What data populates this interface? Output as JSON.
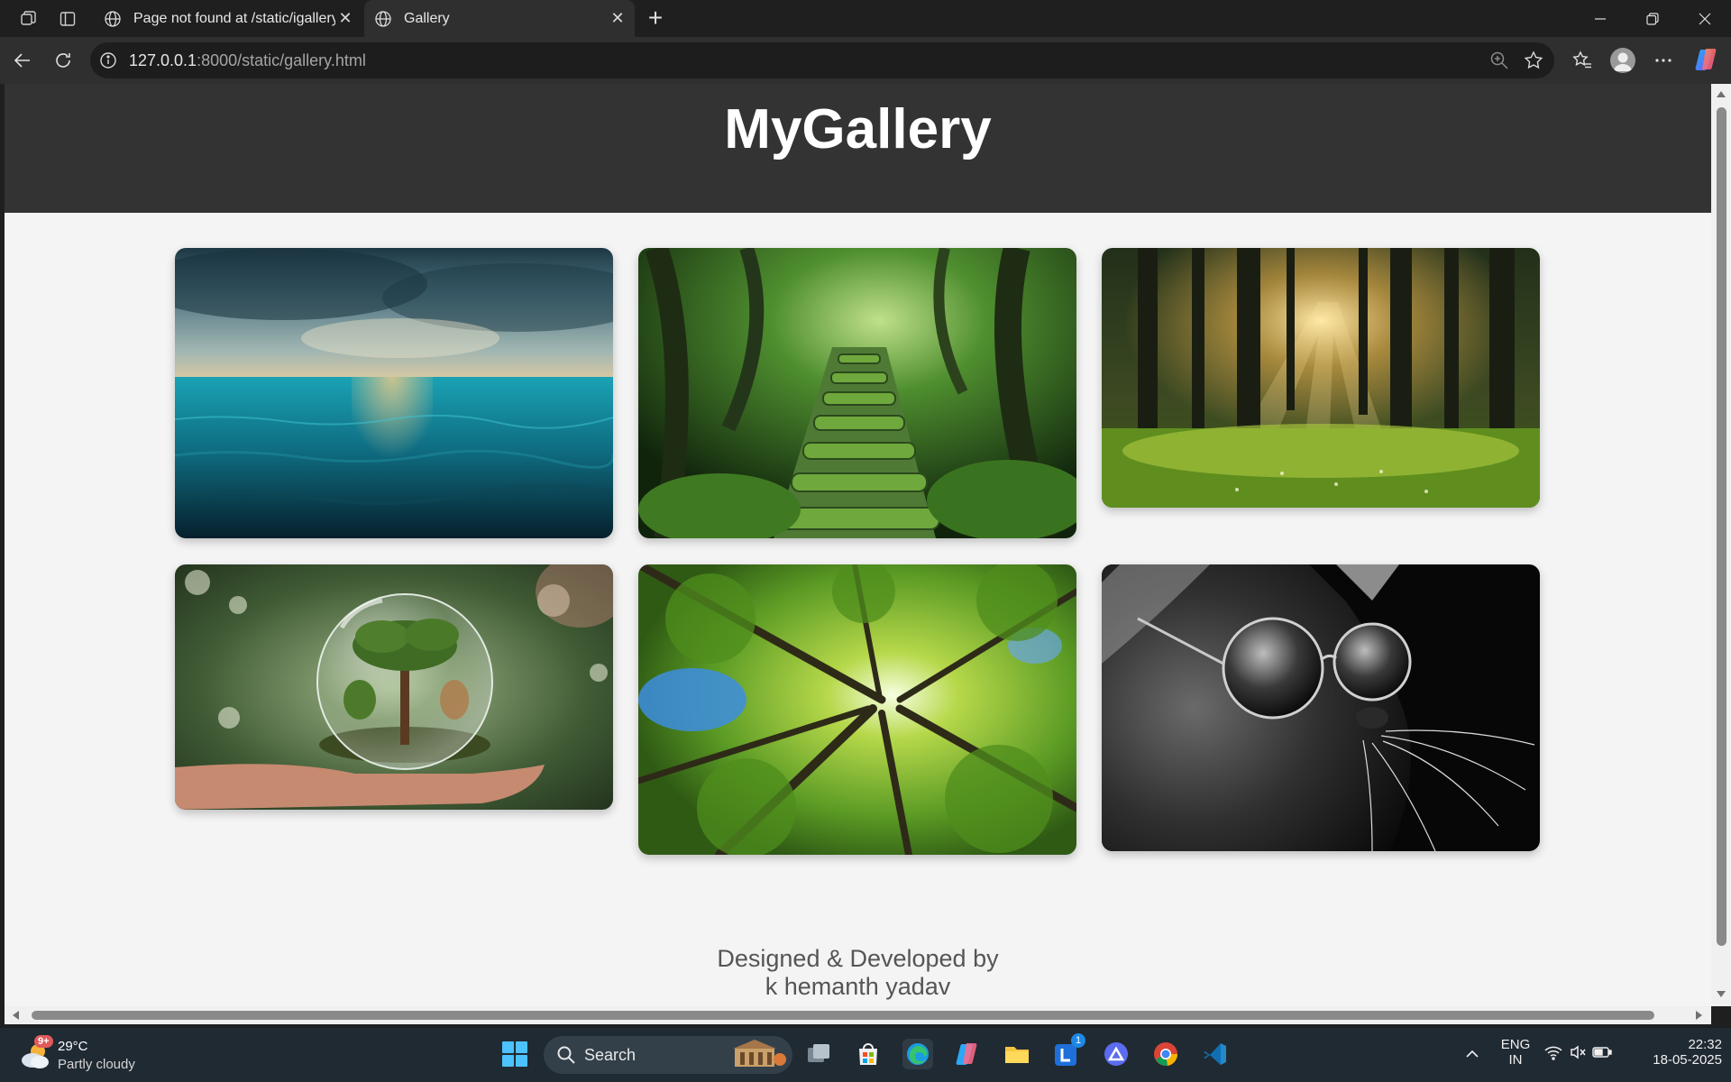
{
  "browser": {
    "tabs": [
      {
        "title": "Page not found at /static/igallery.html",
        "active": false
      },
      {
        "title": "Gallery",
        "active": true
      }
    ],
    "url_host": "127.0.0.1",
    "url_rest": ":8000/static/gallery.html"
  },
  "page": {
    "title": "MyGallery",
    "gallery": [
      {
        "alt": "Stormy ocean at sunset"
      },
      {
        "alt": "Mossy stone stairway in forest"
      },
      {
        "alt": "Sunbeams through forest trees"
      },
      {
        "alt": "Tree in glass globe held in hand"
      },
      {
        "alt": "Looking up into green tree canopy"
      },
      {
        "alt": "Cat wearing sunglasses (black and white)"
      }
    ],
    "footer_line1": "Designed & Developed by",
    "footer_line2": "k hemanth yadav"
  },
  "taskbar": {
    "weather_temp": "29°C",
    "weather_condition": "Partly cloudy",
    "weather_badge": "9+",
    "search_label": "Search",
    "notification_badge": "1",
    "language_line1": "ENG",
    "language_line2": "IN",
    "time": "22:32",
    "date": "18-05-2025"
  }
}
